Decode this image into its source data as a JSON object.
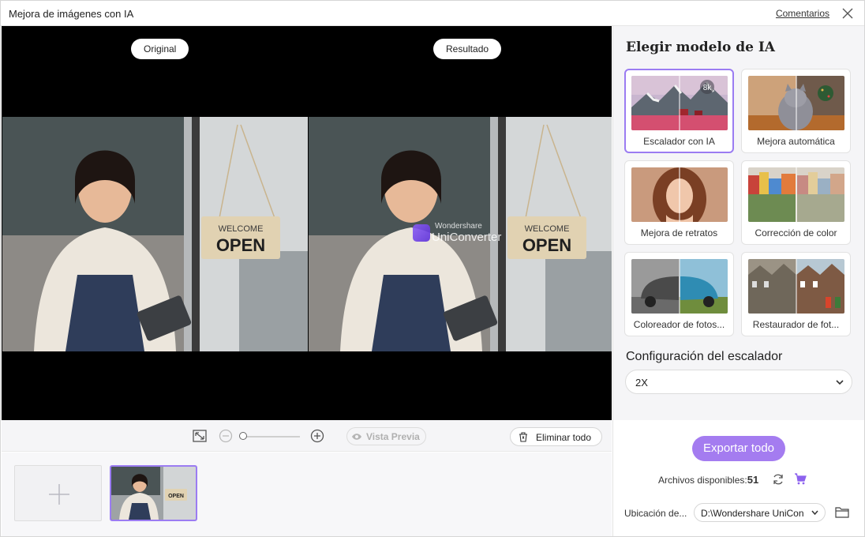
{
  "window": {
    "title": "Mejora de imágenes con IA",
    "feedback_link": "Comentarios",
    "close_icon": "close-icon"
  },
  "preview": {
    "original_label": "Original",
    "result_label": "Resultado",
    "watermark_brand": "Wondershare",
    "watermark_product": "UniConverter",
    "sign_line1": "WELCOME",
    "sign_line2": "OPEN"
  },
  "toolbar": {
    "fit_icon": "fit-screen-icon",
    "zoom_out_icon": "zoom-out-icon",
    "zoom_in_icon": "zoom-in-icon",
    "preview_label": "Vista Previa",
    "delete_all_label": "Eliminar todo"
  },
  "thumbnails": {
    "add_icon": "plus-icon",
    "thumb_sign": "OPEN"
  },
  "panel": {
    "title": "Elegir modelo de IA",
    "models": [
      {
        "label": "Escalador con IA",
        "selected": true,
        "badge": "8k"
      },
      {
        "label": "Mejora automática",
        "selected": false
      },
      {
        "label": "Mejora de retratos",
        "selected": false
      },
      {
        "label": "Corrección de color",
        "selected": false
      },
      {
        "label": "Coloreador de fotos...",
        "selected": false
      },
      {
        "label": "Restaurador de fot...",
        "selected": false
      }
    ],
    "config_label": "Configuración del escalador",
    "scale_value": "2X"
  },
  "export": {
    "button_label": "Exportar todo",
    "files_label": "Archivos disponibles:",
    "files_count": "51",
    "location_label": "Ubicación de...",
    "location_value": "D:\\Wondershare UniCon"
  },
  "colors": {
    "accent": "#a47cf0",
    "selected_border": "#9b7cf2"
  }
}
